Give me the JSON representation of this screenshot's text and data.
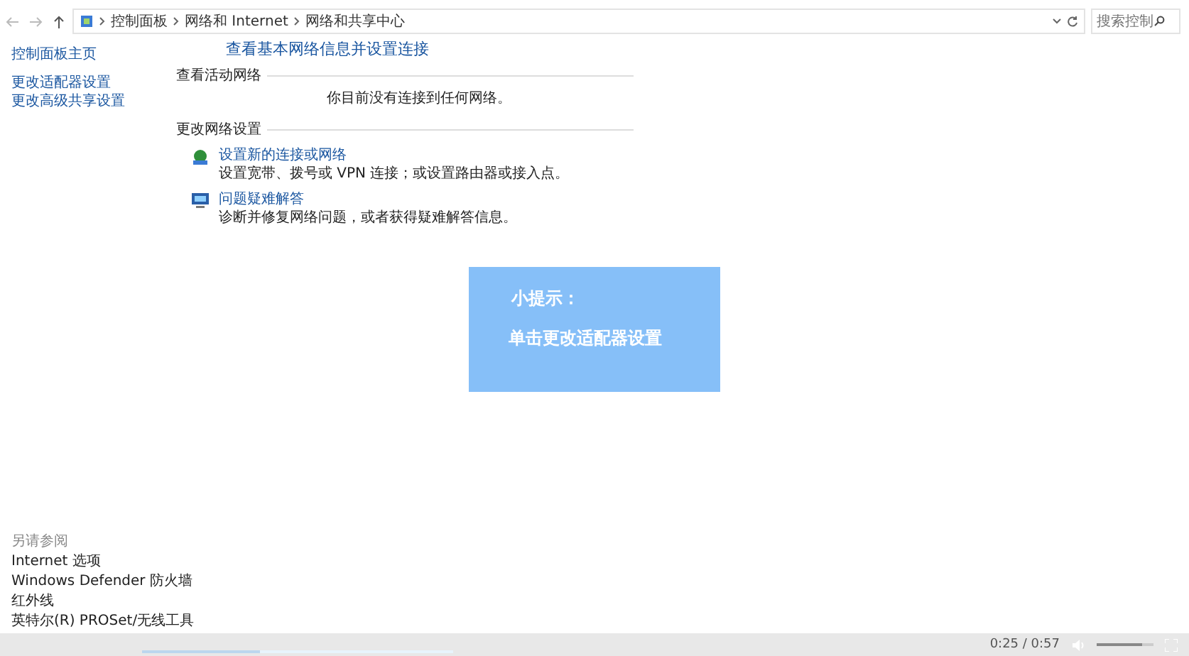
{
  "address_bar": {
    "path": [
      "控制面板",
      "网络和 Internet",
      "网络和共享中心"
    ],
    "search": {
      "placeholder": "搜索控制"
    }
  },
  "sidebar": {
    "items": [
      {
        "label": "控制面板主页"
      },
      {
        "label": "更改适配器设置"
      },
      {
        "label": "更改高级共享设置"
      }
    ],
    "see_also": {
      "heading": "另请参阅",
      "items": [
        "Internet 选项",
        "Windows Defender 防火墙",
        "红外线",
        "英特尔(R) PROSet/无线工具"
      ]
    }
  },
  "main": {
    "title": "查看基本网络信息并设置连接",
    "active_networks": {
      "heading": "查看活动网络",
      "message": "你目前没有连接到任何网络。"
    },
    "change_settings": {
      "heading": "更改网络设置",
      "items": [
        {
          "kind": "new-connection",
          "link": "设置新的连接或网络",
          "description": "设置宽带、拨号或 VPN 连接；或设置路由器或接入点。"
        },
        {
          "kind": "troubleshoot",
          "link": "问题疑难解答",
          "description": "诊断并修复网络问题，或者获得疑难解答信息。"
        }
      ]
    }
  },
  "tip": {
    "heading": "小提示：",
    "text": "单击更改适配器设置"
  },
  "player": {
    "progress": {
      "level": 0.38
    },
    "time": "0:25 / 0:57",
    "volume": {
      "level": 0.8
    }
  }
}
